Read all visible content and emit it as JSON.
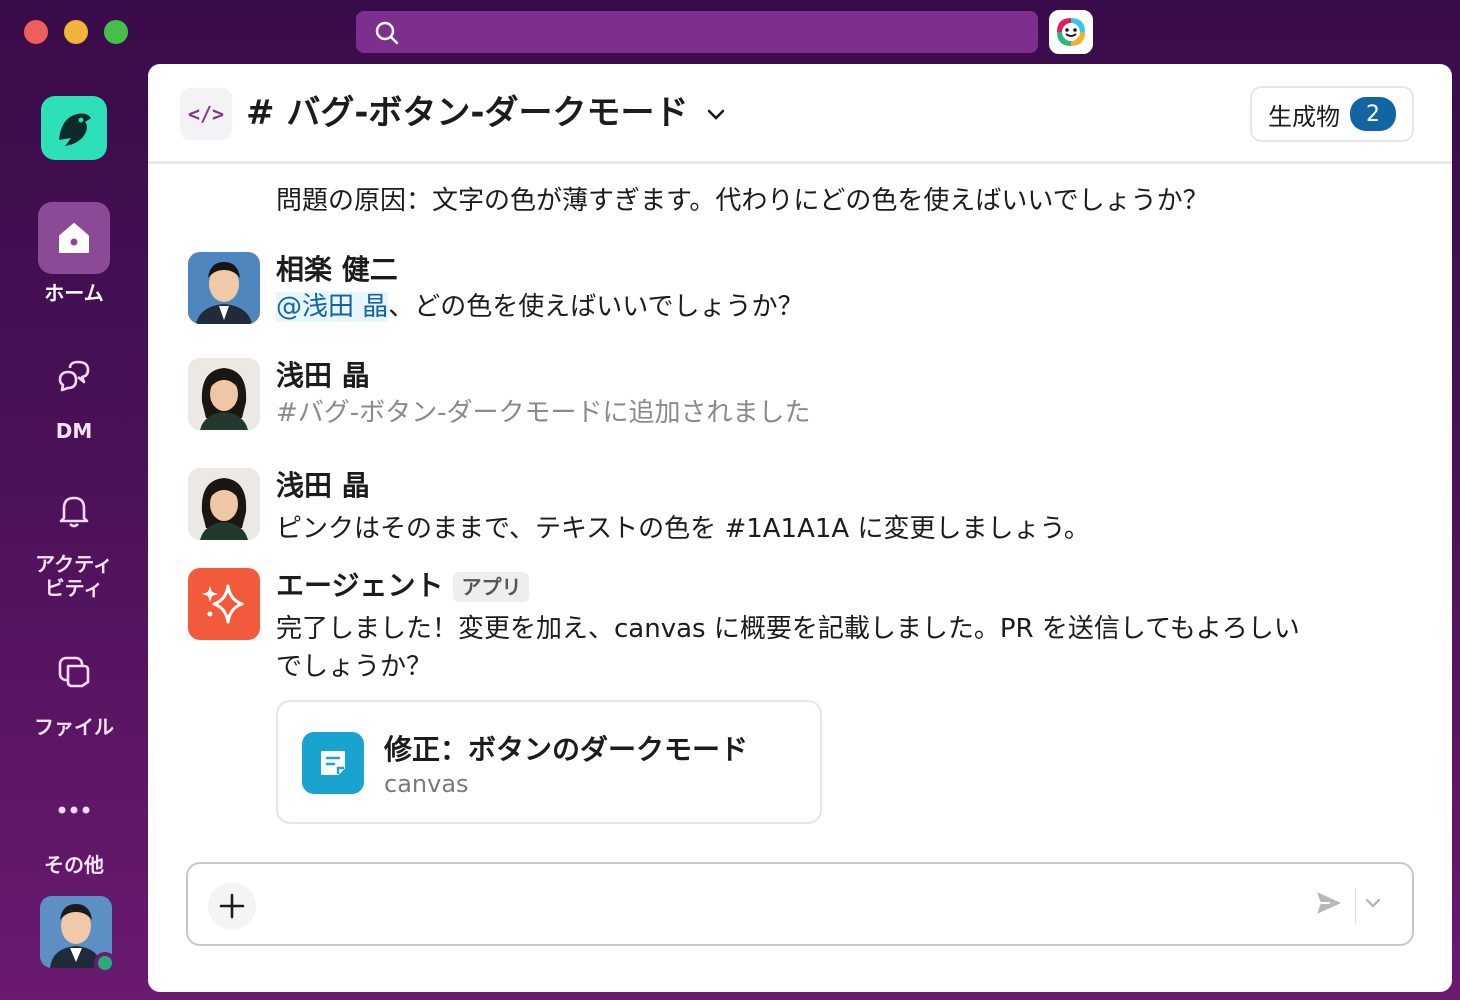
{
  "window": {
    "search_placeholder": ""
  },
  "sidebar": {
    "items": [
      {
        "label": "ホーム",
        "icon": "home-icon",
        "active": true
      },
      {
        "label": "DM",
        "icon": "dm-icon",
        "active": false
      },
      {
        "label": "アクティ\nビティ",
        "icon": "bell-icon",
        "active": false
      },
      {
        "label": "ファイル",
        "icon": "files-icon",
        "active": false
      },
      {
        "label": "その他",
        "icon": "more-icon",
        "active": false
      }
    ]
  },
  "header": {
    "channel_icon": "</>",
    "channel_name": "# バグ-ボタン-ダークモード",
    "artifacts_label": "生成物",
    "artifacts_count": "2"
  },
  "messages": {
    "continuation": "問題の原因：文字の色が薄すぎます。代わりにどの色を使えばいいでしょうか？",
    "m1": {
      "sender": "相楽 健二",
      "mention": "@浅田 晶",
      "text": "、どの色を使えばいいでしょうか？"
    },
    "m2": {
      "sender": "浅田 晶",
      "text": "#バグ-ボタン-ダークモードに追加されました"
    },
    "m3": {
      "sender": "浅田 晶",
      "text": "ピンクはそのままで、テキストの色を #1A1A1A に変更しましょう。"
    },
    "m4": {
      "sender": "エージェント",
      "tag": "アプリ",
      "line1": "完了しました！変更を加え、canvas に概要を記載しました。PR を送信してもよろしい",
      "line2": "でしょうか？"
    }
  },
  "canvas_card": {
    "title": "修正：ボタンのダークモード",
    "subtitle": "canvas"
  },
  "composer": {
    "placeholder": ""
  },
  "colors": {
    "accent": "#1264a3",
    "workspace": "#2ee0b8",
    "agent": "#f15a3b",
    "canvas": "#19a4cf"
  }
}
